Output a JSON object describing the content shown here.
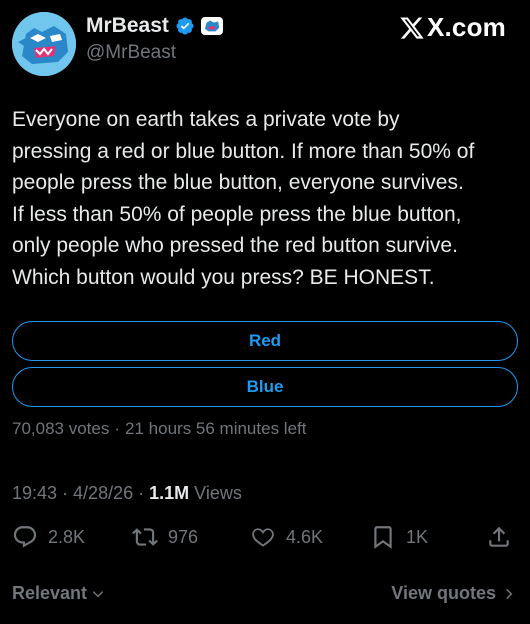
{
  "author": {
    "display_name": "MrBeast",
    "handle": "@MrBeast",
    "avatar_icon": "beast-panther-avatar",
    "verified_icon": "verified-badge-icon",
    "affiliate_icon": "beast-affiliate-badge-icon"
  },
  "brand": {
    "text": "X.com"
  },
  "tweet": {
    "text": "Everyone on earth takes a private vote by\npressing a red or blue button. If more than 50% of\npeople press the blue button, everyone survives.\nIf less than 50% of people press the blue button,\nonly people who pressed the red button survive.\nWhich button would you press? BE HONEST."
  },
  "poll": {
    "options": [
      "Red",
      "Blue"
    ],
    "votes": "70,083 votes",
    "separator": "·",
    "time_left": "21 hours 56 minutes left"
  },
  "meta": {
    "time": "19:43",
    "date": "4/28/26",
    "separator": "·",
    "views_count": "1.1M",
    "views_label": "Views"
  },
  "actions": {
    "replies": "2.8K",
    "reposts": "976",
    "likes": "4.6K",
    "bookmarks": "1K"
  },
  "footer": {
    "sort_label": "Relevant",
    "quotes_label": "View quotes"
  },
  "colors": {
    "accent": "#1d9bf0",
    "background": "#000000",
    "text": "#e7e9ea",
    "secondary": "#71767b"
  }
}
